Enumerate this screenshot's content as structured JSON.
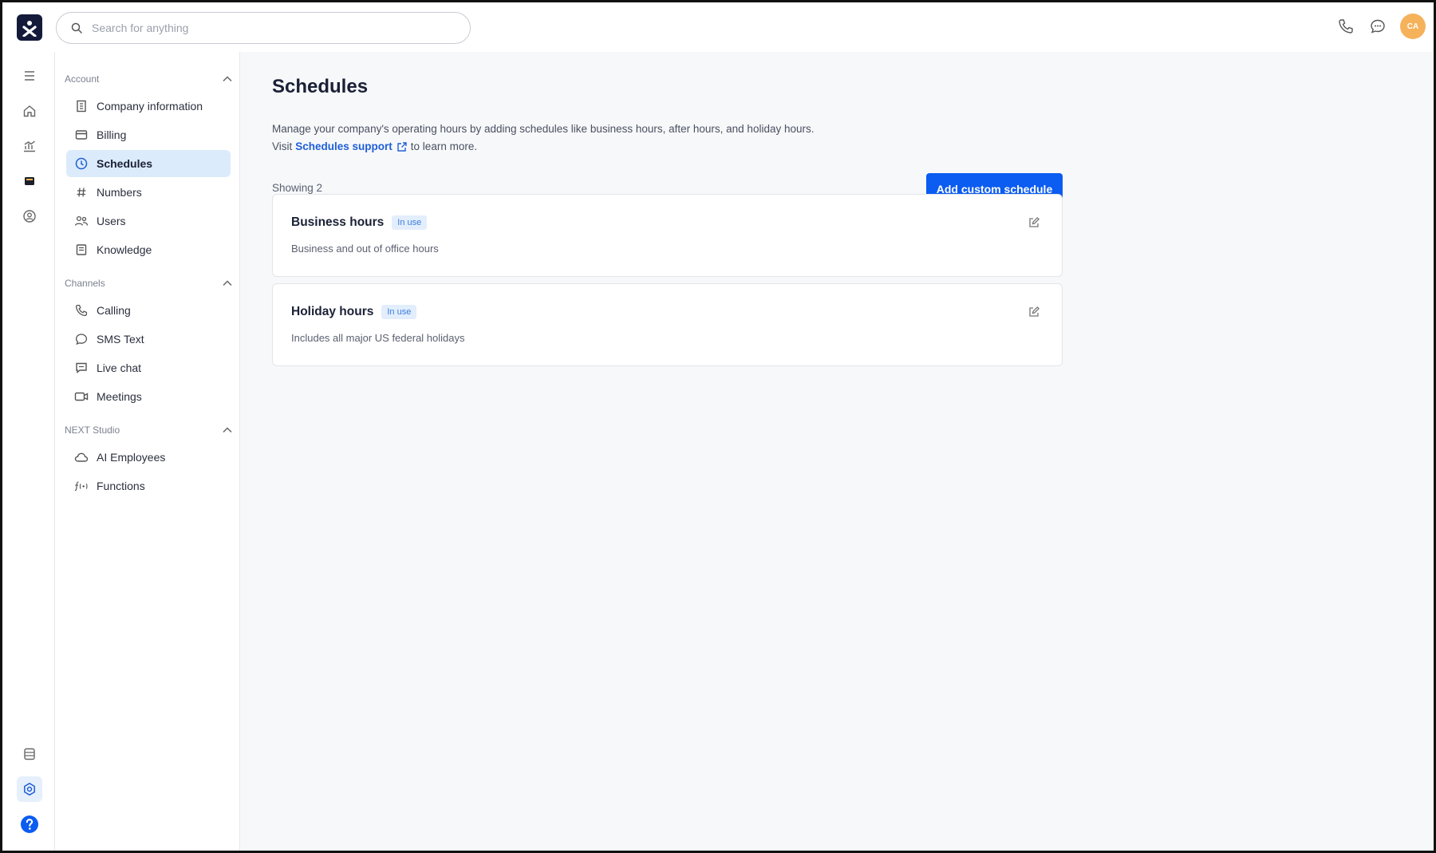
{
  "app": {
    "logo_letter": "x",
    "search_placeholder": "Search for anything",
    "avatar_initials": "CA",
    "accent": "#0b5cf0"
  },
  "sidebar": {
    "sections": [
      {
        "title": "Account",
        "items": [
          {
            "label": "Company information",
            "icon": "building-icon"
          },
          {
            "label": "Billing",
            "icon": "credit-card-icon"
          },
          {
            "label": "Schedules",
            "icon": "clock-icon",
            "active": true
          },
          {
            "label": "Numbers",
            "icon": "hash-icon"
          },
          {
            "label": "Users",
            "icon": "users-icon"
          },
          {
            "label": "Knowledge",
            "icon": "book-icon"
          }
        ]
      },
      {
        "title": "Channels",
        "items": [
          {
            "label": "Calling",
            "icon": "phone-icon"
          },
          {
            "label": "SMS Text",
            "icon": "chat-bubble-icon"
          },
          {
            "label": "Live chat",
            "icon": "live-chat-icon"
          },
          {
            "label": "Meetings",
            "icon": "video-icon"
          }
        ]
      },
      {
        "title": "NEXT Studio",
        "items": [
          {
            "label": "AI Employees",
            "icon": "cloud-icon"
          },
          {
            "label": "Functions",
            "icon": "function-icon"
          }
        ]
      }
    ]
  },
  "main": {
    "title": "Schedules",
    "description_line1": "Manage your company's operating hours by adding schedules like business hours, after hours, and holiday hours.",
    "description_visit": "Visit",
    "support_link": "Schedules support",
    "description_tail": "to learn more.",
    "showing": "Showing 2",
    "add_button": "Add custom schedule",
    "schedules": [
      {
        "name": "Business hours",
        "badge": "In use",
        "subtitle": "Business and out of office hours"
      },
      {
        "name": "Holiday hours",
        "badge": "In use",
        "subtitle": "Includes all major US federal holidays"
      }
    ]
  }
}
